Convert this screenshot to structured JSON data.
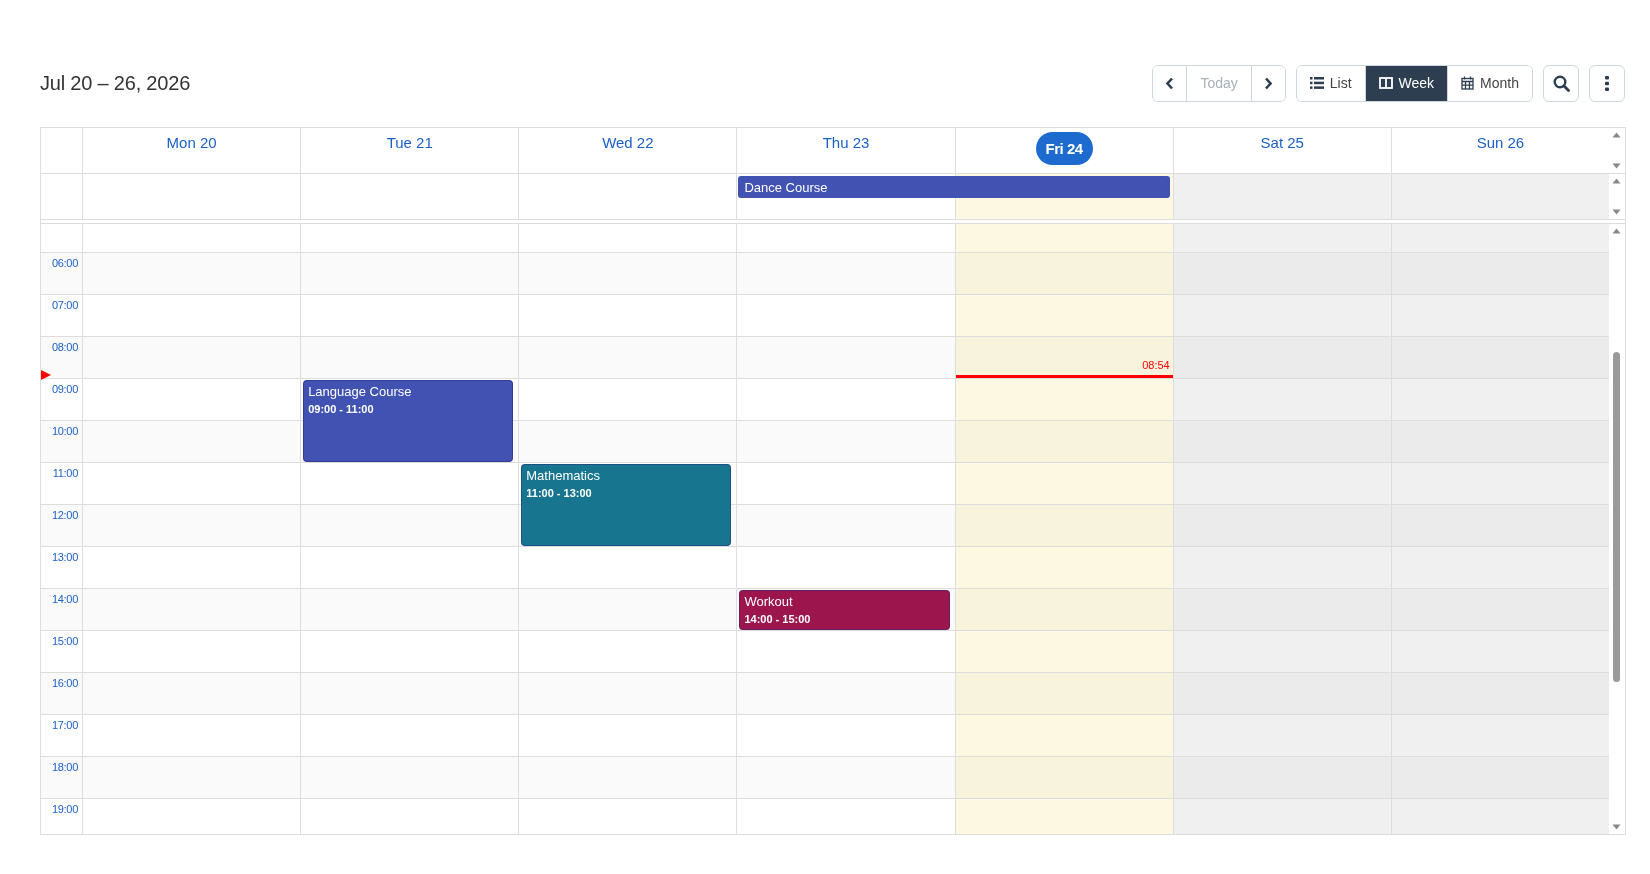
{
  "title": "Jul 20 – 26, 2026",
  "toolbar": {
    "today": {
      "label": "Today",
      "disabled": true
    },
    "views": [
      {
        "kind": "list",
        "label": "List",
        "selected": false
      },
      {
        "kind": "week",
        "label": "Week",
        "selected": true
      },
      {
        "kind": "month",
        "label": "Month",
        "selected": false
      }
    ]
  },
  "hours": [
    "06:00",
    "07:00",
    "08:00",
    "09:00",
    "10:00",
    "11:00",
    "12:00",
    "13:00",
    "14:00",
    "15:00",
    "16:00",
    "17:00",
    "18:00",
    "19:00"
  ],
  "days": [
    {
      "label": "Mon 20",
      "today": false,
      "weekend": false
    },
    {
      "label": "Tue 21",
      "today": false,
      "weekend": false,
      "events": [
        {
          "title": "Language Course",
          "time": "09:00 - 11:00",
          "color": "#4152b3"
        }
      ]
    },
    {
      "label": "Wed 22",
      "today": false,
      "weekend": false,
      "events": [
        {
          "title": "Mathematics",
          "time": "11:00 - 13:00",
          "color": "#17758f"
        }
      ]
    },
    {
      "label": "Thu 23",
      "today": false,
      "weekend": false,
      "all_day": [
        {
          "title": "Dance Course",
          "color": "#4152b3",
          "continues_next_day": true
        }
      ],
      "events": [
        {
          "title": "Workout",
          "time": "14:00 - 15:00",
          "color": "#9c164d"
        }
      ]
    },
    {
      "label": "Fri 24",
      "today": true,
      "weekend": false,
      "now": {
        "time": "08:54"
      }
    },
    {
      "label": "Sat 25",
      "today": false,
      "weekend": true
    },
    {
      "label": "Sun 26",
      "today": false,
      "weekend": true
    }
  ]
}
